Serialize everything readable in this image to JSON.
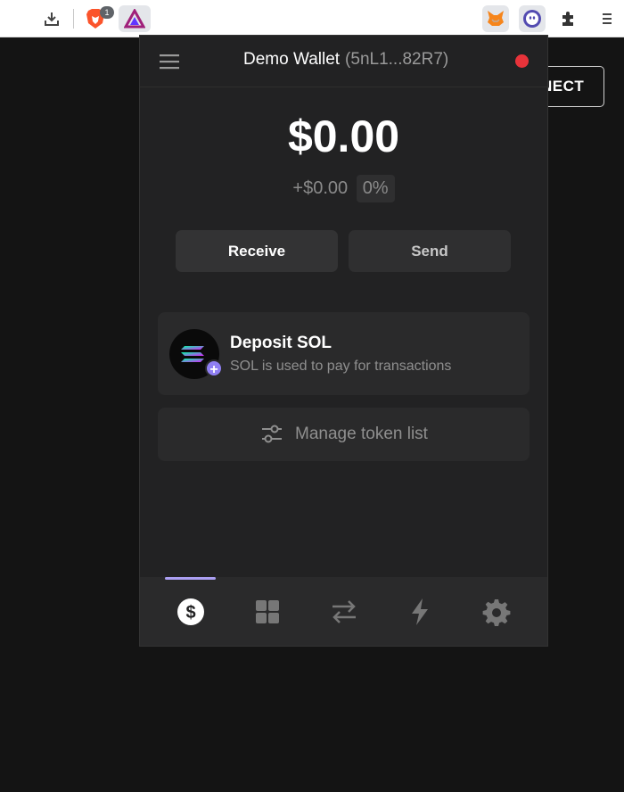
{
  "browser": {
    "extensions": [
      {
        "name": "download-icon"
      },
      {
        "name": "brave-lion-icon",
        "badge": "1"
      },
      {
        "name": "brave-rewards-icon"
      },
      {
        "name": "metamask-fox-icon"
      },
      {
        "name": "phantom-ghost-icon"
      },
      {
        "name": "puzzle-icon"
      },
      {
        "name": "kebab-menu-icon"
      }
    ]
  },
  "page": {
    "connect_label": "NECT"
  },
  "wallet": {
    "title": "Demo Wallet",
    "address": "(5nL1...82R7)",
    "status_color": "#e8333a",
    "balance": "$0.00",
    "change_amount": "+$0.00",
    "change_percent": "0%",
    "receive_label": "Receive",
    "send_label": "Send",
    "deposit": {
      "title": "Deposit SOL",
      "subtitle": "SOL is used to pay for transactions"
    },
    "manage_label": "Manage token list",
    "nav": [
      {
        "name": "dollar-icon",
        "active": true
      },
      {
        "name": "grid-icon",
        "active": false
      },
      {
        "name": "swap-icon",
        "active": false
      },
      {
        "name": "lightning-icon",
        "active": false
      },
      {
        "name": "gear-icon",
        "active": false
      }
    ],
    "accent_color": "#ab9ff2"
  }
}
